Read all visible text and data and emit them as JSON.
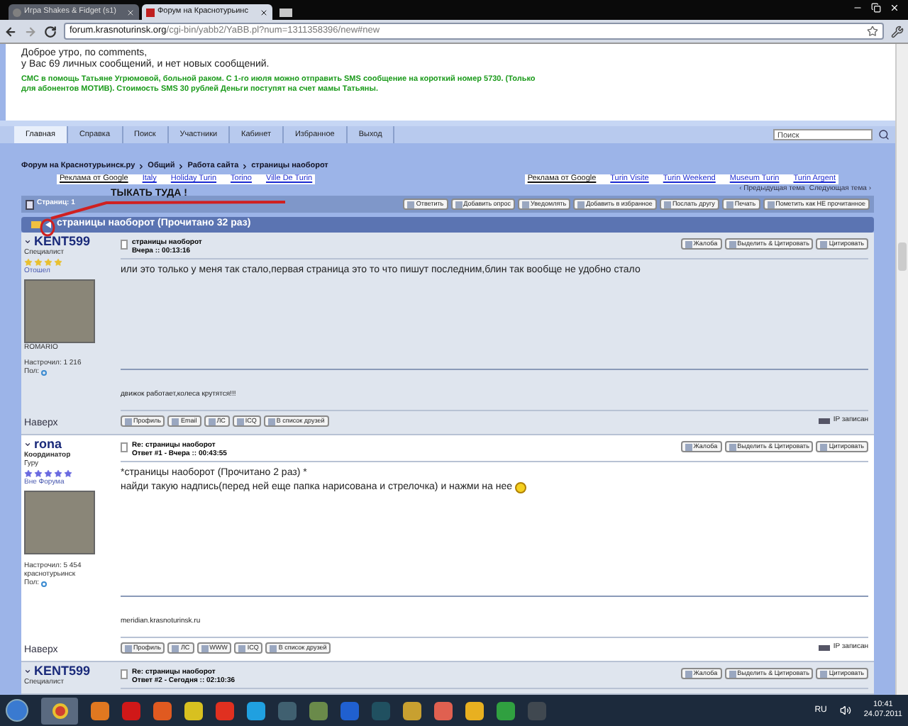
{
  "browser": {
    "tabs": [
      {
        "label": "Игра Shakes & Fidget (s1)",
        "selected": false
      },
      {
        "label": "Форум на Краснотурьинс",
        "selected": true
      }
    ],
    "url_host": "forum.krasnoturinsk.org",
    "url_path": "/cgi-bin/yabb2/YaBB.pl?num=1311358396/new#new"
  },
  "greeting": {
    "lines": [
      "Доброе утро, по comments,",
      "у Вас 69 личных сообщений, и нет новых сообщений."
    ],
    "notice": "СМС в помощь Татьяне Угрюмовой, больной раком.  С 1-го июля можно отправить SMS сообщение на короткий номер 5730. (Только для абонентов МОТИВ). Стоимость SMS 30 рублей Деньги поступят на счет мамы Татьяны."
  },
  "nav": {
    "items": [
      {
        "label": "Главная",
        "selected": true
      },
      {
        "label": "Справка",
        "selected": false
      },
      {
        "label": "Поиск",
        "selected": false
      },
      {
        "label": "Участники",
        "selected": false
      },
      {
        "label": "Кабинет",
        "selected": false
      },
      {
        "label": "Избранное",
        "selected": false
      },
      {
        "label": "Выход",
        "selected": false
      }
    ],
    "search_placeholder": "Поиск"
  },
  "breadcrumb": [
    "Форум на Краснотурьинск.ру",
    "Общий",
    "Работа сайта",
    "страницы наоборот"
  ],
  "ads": [
    {
      "title": "Реклама от Google",
      "links": [
        "Italy",
        "Holiday Turin",
        "Torino",
        "Ville De Turin"
      ]
    },
    {
      "title": "Реклама от Google",
      "links": [
        "Turin Visite",
        "Turin Weekend",
        "Museum Turin",
        "Turin Argent"
      ]
    }
  ],
  "topic_nav": [
    "‹ Предыдущая тема",
    "Следующая тема ›"
  ],
  "toolbar": {
    "pages": "Страниц: 1",
    "buttons": [
      "Ответить",
      "Добавить опрос",
      "Уведомлять",
      "Добавить в избранное",
      "Послать другу",
      "Печать",
      "Пометить как НЕ прочитанное"
    ]
  },
  "annotation": "ТЫКАТЬ ТУДА !",
  "topic_title": "страницы наоборот (Прочитано 32 раз)",
  "posts": [
    {
      "author": "KENT599",
      "rank": "Специалист",
      "stars": 4,
      "color": "#e8c030",
      "status": "Отошел",
      "name_line": "ROMARIO",
      "post_count": "Настрочил: 1 216",
      "gender": "Пол:",
      "top_link": "Наверх",
      "subject": "страницы наоборот",
      "meta": "Вчера :: 00:13:16",
      "actions": [
        "Жалоба",
        "Выделить & Цитировать",
        "Цитировать"
      ],
      "body": [
        "или это только у меня так стало,первая страница это то что пишут последним,блин так вообще не удобно стало"
      ],
      "signature": "движок работает,колеса крутятся!!!",
      "profile_buttons": [
        "Профиль",
        "Email",
        "ЛС",
        "ICQ",
        "В список друзей"
      ],
      "ip": "IP записан"
    },
    {
      "author": "rona",
      "rank": "Координатор",
      "title": "Гуру",
      "stars": 5,
      "color": "#6a6ae0",
      "status": "Вне Форума",
      "post_count": "Настрочил: 5 454",
      "location": "краснотурьинск",
      "gender": "Пол:",
      "top_link": "Наверх",
      "subject": "Re: страницы наоборот",
      "meta": "Ответ #1 - Вчера :: 00:43:55",
      "actions": [
        "Жалоба",
        "Выделить & Цитировать",
        "Цитировать"
      ],
      "body": [
        "*страницы наоборот (Прочитано 2 раз) *",
        "найди такую надпись(перед ней еще папка нарисована и стрелочка) и нажми на нее"
      ],
      "smiley": true,
      "signature": "meridian.krasnoturinsk.ru",
      "profile_buttons": [
        "Профиль",
        "ЛС",
        "WWW",
        "ICQ",
        "В список друзей"
      ],
      "ip": "IP записан"
    },
    {
      "author": "KENT599",
      "rank": "Специалист",
      "subject": "Re: страницы наоборот",
      "meta": "Ответ #2 - Сегодня :: 02:10:36",
      "actions": [
        "Жалоба",
        "Выделить & Цитировать",
        "Цитировать"
      ]
    }
  ],
  "taskbar": {
    "lang": "RU",
    "time": "10:41",
    "date": "24.07.2011"
  }
}
